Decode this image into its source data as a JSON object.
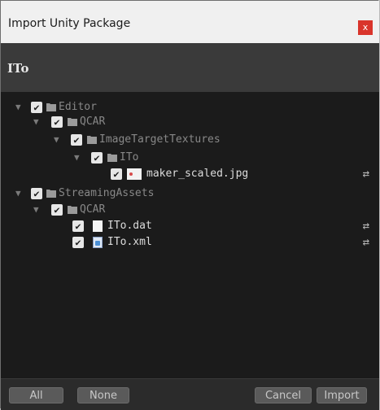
{
  "window": {
    "title": "Import Unity Package",
    "close_glyph": "x"
  },
  "header": {
    "package_name": "ITo"
  },
  "tree": {
    "items": [
      {
        "label": "Editor",
        "icon": "folder-icon",
        "checked": true
      },
      {
        "label": "QCAR",
        "icon": "folder-icon",
        "checked": true
      },
      {
        "label": "ImageTargetTextures",
        "icon": "folder-icon",
        "checked": true
      },
      {
        "label": "ITo",
        "icon": "folder-icon",
        "checked": true
      },
      {
        "label": "maker_scaled.jpg",
        "icon": "image-thumbnail-icon",
        "checked": true,
        "reimport": true
      },
      {
        "label": "StreamingAssets",
        "icon": "folder-icon",
        "checked": true
      },
      {
        "label": "QCAR",
        "icon": "folder-icon",
        "checked": true
      },
      {
        "label": "ITo.dat",
        "icon": "file-icon",
        "checked": true,
        "reimport": true
      },
      {
        "label": "ITo.xml",
        "icon": "xml-file-icon",
        "checked": true,
        "reimport": true
      }
    ]
  },
  "footer": {
    "all_label": "All",
    "none_label": "None",
    "cancel_label": "Cancel",
    "import_label": "Import"
  },
  "colors": {
    "accent_close": "#d9342b",
    "tree_bg": "#1b1b1b",
    "header_bg": "#3a3a3a"
  },
  "glyphs": {
    "expand": "▼",
    "check": "✔",
    "reimport": "⇄"
  }
}
